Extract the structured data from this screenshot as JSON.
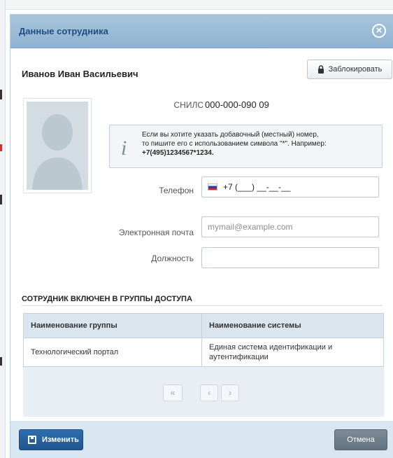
{
  "dialog": {
    "title": "Данные сотрудника",
    "close_icon": "close-icon"
  },
  "employee": {
    "name": "Иванов Иван Васильевич",
    "block_label": "Заблокировать",
    "snils_label": "СНИЛС",
    "snils_value": "000-000-090 09"
  },
  "info": {
    "line1": "Если вы хотите указать добавочный (местный) номер,",
    "line2": "то пишите его с использованием символа \"*\". Например:",
    "example": "+7(495)1234567*1234."
  },
  "form": {
    "phone_label": "Телефон",
    "phone_value": "+7 (___) __-__-__",
    "email_label": "Электронная почта",
    "email_placeholder": "mymail@example.com",
    "position_label": "Должность",
    "position_value": ""
  },
  "groups": {
    "title": "СОТРУДНИК ВКЛЮЧЕН В ГРУППЫ ДОСТУПА",
    "columns": [
      "Наименование группы",
      "Наименование системы"
    ],
    "rows": [
      [
        "Технологический портал",
        "Единая система идентификации и аутентификации"
      ]
    ],
    "pager": {
      "first": "«",
      "prev": "‹",
      "next": "›"
    }
  },
  "footer": {
    "edit_label": "Изменить",
    "cancel_label": "Отмена"
  },
  "colors": {
    "header": "#8fb2cf",
    "title": "#1e4d84",
    "primary_button": "#1f568f",
    "secondary_button": "#637280"
  }
}
